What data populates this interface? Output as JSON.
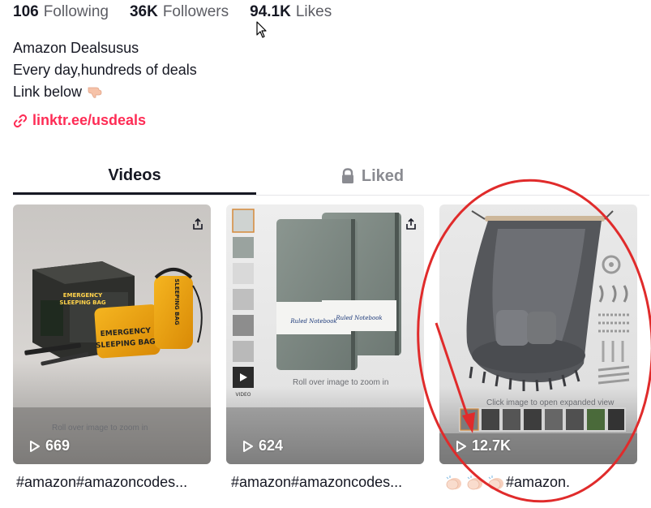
{
  "stats": {
    "following_count": "106",
    "following_label": "Following",
    "followers_count": "36K",
    "followers_label": "Followers",
    "likes_count": "94.1K",
    "likes_label": "Likes"
  },
  "bio": {
    "name": "Amazon Dealsusus",
    "line1": "Every day,hundreds of deals",
    "line2": "Link below"
  },
  "link": {
    "text": "linktr.ee/usdeals"
  },
  "tabs": {
    "videos": "Videos",
    "liked": "Liked"
  },
  "videos": [
    {
      "views": "669",
      "caption": "#amazon#amazoncodes...",
      "overlay_text": "Roll over image to zoom in",
      "bag_label_1": "EMERGENCY",
      "bag_label_2": "SLEEPING BAG"
    },
    {
      "views": "624",
      "caption": "#amazon#amazoncodes...",
      "overlay_text": "Roll over image to zoom in",
      "notebook_label": "Ruled Notebook",
      "sidebar_video": "VIDEO"
    },
    {
      "views": "12.7K",
      "caption": "#amazon.",
      "overlay_text": "Click image to open expanded view"
    }
  ],
  "colors": {
    "accent": "#fe2c55",
    "annotation": "#e02b2b",
    "text": "#161823",
    "muted": "#8a8b91"
  },
  "icons": [
    "link-icon",
    "lock-icon",
    "play-icon",
    "share-icon",
    "pointing-down-emoji-icon",
    "clap-emoji-icon",
    "cursor-icon"
  ]
}
